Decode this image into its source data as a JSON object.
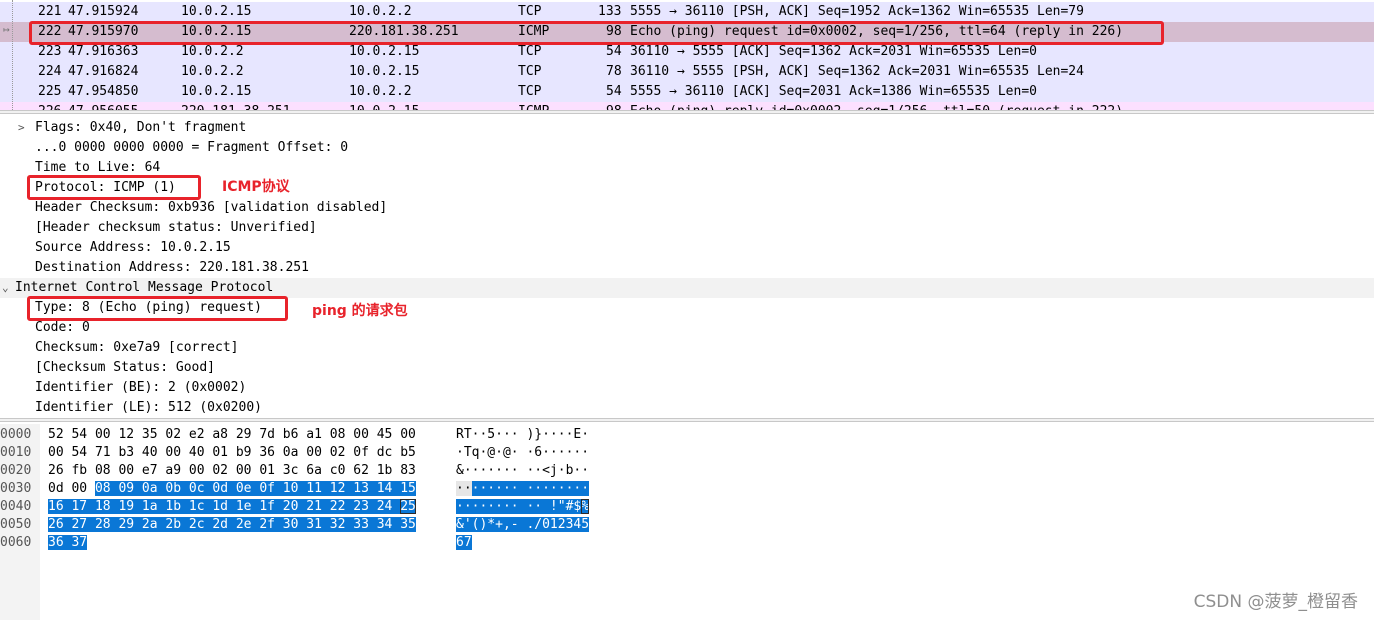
{
  "colors": {
    "tcp_row": "#e7e6ff",
    "icmp_row": "#fce0ff",
    "selected_row": "#d5bccf",
    "byte_selection": "#0a77d6",
    "annotation": "#e8232b"
  },
  "packets": [
    {
      "no": "221",
      "time": "47.915924",
      "src": "10.0.2.15",
      "dst": "10.0.2.2",
      "proto": "TCP",
      "len": "133",
      "info": "5555 → 36110 [PSH, ACK] Seq=1952 Ack=1362 Win=65535 Len=79"
    },
    {
      "no": "222",
      "time": "47.915970",
      "src": "10.0.2.15",
      "dst": "220.181.38.251",
      "proto": "ICMP",
      "len": "98",
      "info": "Echo (ping) request  id=0x0002, seq=1/256, ttl=64 (reply in 226)"
    },
    {
      "no": "223",
      "time": "47.916363",
      "src": "10.0.2.2",
      "dst": "10.0.2.15",
      "proto": "TCP",
      "len": "54",
      "info": "36110 → 5555 [ACK] Seq=1362 Ack=2031 Win=65535 Len=0"
    },
    {
      "no": "224",
      "time": "47.916824",
      "src": "10.0.2.2",
      "dst": "10.0.2.15",
      "proto": "TCP",
      "len": "78",
      "info": "36110 → 5555 [PSH, ACK] Seq=1362 Ack=2031 Win=65535 Len=24"
    },
    {
      "no": "225",
      "time": "47.954850",
      "src": "10.0.2.15",
      "dst": "10.0.2.2",
      "proto": "TCP",
      "len": "54",
      "info": "5555 → 36110 [ACK] Seq=2031 Ack=1386 Win=65535 Len=0"
    },
    {
      "no": "226",
      "time": "47.956055",
      "src": "220.181.38.251",
      "dst": "10.0.2.15",
      "proto": "ICMP",
      "len": "98",
      "info": "Echo (ping) reply    id=0x0002, seq=1/256, ttl=50 (request in 222)"
    }
  ],
  "details": {
    "ip_flags": "Flags: 0x40, Don't fragment",
    "ip_frag": "...0 0000 0000 0000 = Fragment Offset: 0",
    "ip_ttl": "Time to Live: 64",
    "ip_protocol": "Protocol: ICMP (1)",
    "ip_checksum": "Header Checksum: 0xb936 [validation disabled]",
    "ip_checksum_status": "[Header checksum status: Unverified]",
    "ip_src": "Source Address: 10.0.2.15",
    "ip_dst": "Destination Address: 220.181.38.251",
    "icmp_header": "Internet Control Message Protocol",
    "icmp_type": "Type: 8 (Echo (ping) request)",
    "icmp_code": "Code: 0",
    "icmp_checksum": "Checksum: 0xe7a9 [correct]",
    "icmp_checksum_status": "[Checksum Status: Good]",
    "icmp_id_be": "Identifier (BE): 2 (0x0002)",
    "icmp_id_le": "Identifier (LE): 512 (0x0200)"
  },
  "bytes": [
    {
      "offset": "0000",
      "hex": "52 54 00 12 35 02 e2 a8  29 7d b6 a1 08 00 45 00",
      "ascii": "RT··5··· )}····E·"
    },
    {
      "offset": "0010",
      "hex": "00 54 71 b3 40 00 40 01  b9 36 0a 00 02 0f dc b5",
      "ascii": "·Tq·@·@· ·6······"
    },
    {
      "offset": "0020",
      "hex": "26 fb 08 00 e7 a9 00 02  00 01 3c 6a c0 62 1b 83",
      "ascii": "&······· ··<j·b··"
    },
    {
      "offset": "0030",
      "hex_plain": "0d 00 ",
      "hex_sel": "08 09 0a 0b 0c 0d  0e 0f 10 11 12 13 14 15",
      "ascii_plain": "··",
      "ascii_sel": "······ ········"
    },
    {
      "offset": "0040",
      "hex_sel_a": "16 17 18 19 1a 1b 1c 1d  1e 1f 20 21 22 23 24 ",
      "hex_box": "25",
      "ascii_sel_a": "········ ·· !\"#$",
      "ascii_box": "%"
    },
    {
      "offset": "0050",
      "hex_sel": "26 27 28 29 2a 2b 2c 2d  2e 2f 30 31 32 33 34 35",
      "ascii_sel": "&'()*+,- ./012345"
    },
    {
      "offset": "0060",
      "hex_sel": "36 37",
      "ascii_sel": "67"
    }
  ],
  "annotations": {
    "protocol_note": "ICMP协议",
    "type_note": "ping 的请求包"
  },
  "watermark": "CSDN @菠萝_橙留香"
}
